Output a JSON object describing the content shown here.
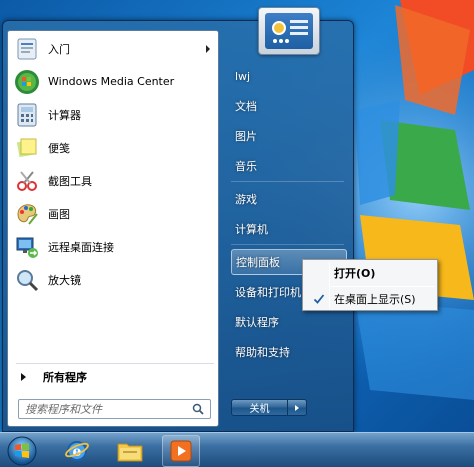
{
  "left_programs": [
    {
      "label": "入门",
      "icon": "getting-started-icon",
      "has_submenu": true
    },
    {
      "label": "Windows Media Center",
      "icon": "windows-media-center-icon",
      "has_submenu": false
    },
    {
      "label": "计算器",
      "icon": "calculator-icon",
      "has_submenu": false
    },
    {
      "label": "便笺",
      "icon": "sticky-notes-icon",
      "has_submenu": false
    },
    {
      "label": "截图工具",
      "icon": "snipping-tool-icon",
      "has_submenu": false
    },
    {
      "label": "画图",
      "icon": "paint-icon",
      "has_submenu": false
    },
    {
      "label": "远程桌面连接",
      "icon": "remote-desktop-icon",
      "has_submenu": false
    },
    {
      "label": "放大镜",
      "icon": "magnifier-icon",
      "has_submenu": false
    }
  ],
  "all_programs_label": "所有程序",
  "search": {
    "placeholder": "搜索程序和文件"
  },
  "right_links": [
    {
      "label": "lwj"
    },
    {
      "label": "文档"
    },
    {
      "label": "图片"
    },
    {
      "label": "音乐"
    },
    {
      "label": "游戏"
    },
    {
      "label": "计算机"
    },
    {
      "label": "控制面板"
    },
    {
      "label": "设备和打印机"
    },
    {
      "label": "默认程序"
    },
    {
      "label": "帮助和支持"
    }
  ],
  "shutdown_label": "关机",
  "context_menu": {
    "items": [
      {
        "label": "打开(O)",
        "bold": true,
        "checked": false
      },
      {
        "label": "在桌面上显示(S)",
        "bold": false,
        "checked": true
      }
    ]
  },
  "taskbar": {
    "items": [
      "start-orb-icon",
      "internet-explorer-icon",
      "windows-explorer-icon",
      "media-player-icon"
    ]
  },
  "colors": {
    "desktop_blue": "#1a6fb5",
    "menu_glass": "#286eaa",
    "hover_highlight": "#ffffff",
    "check_blue": "#1f5fa8"
  }
}
